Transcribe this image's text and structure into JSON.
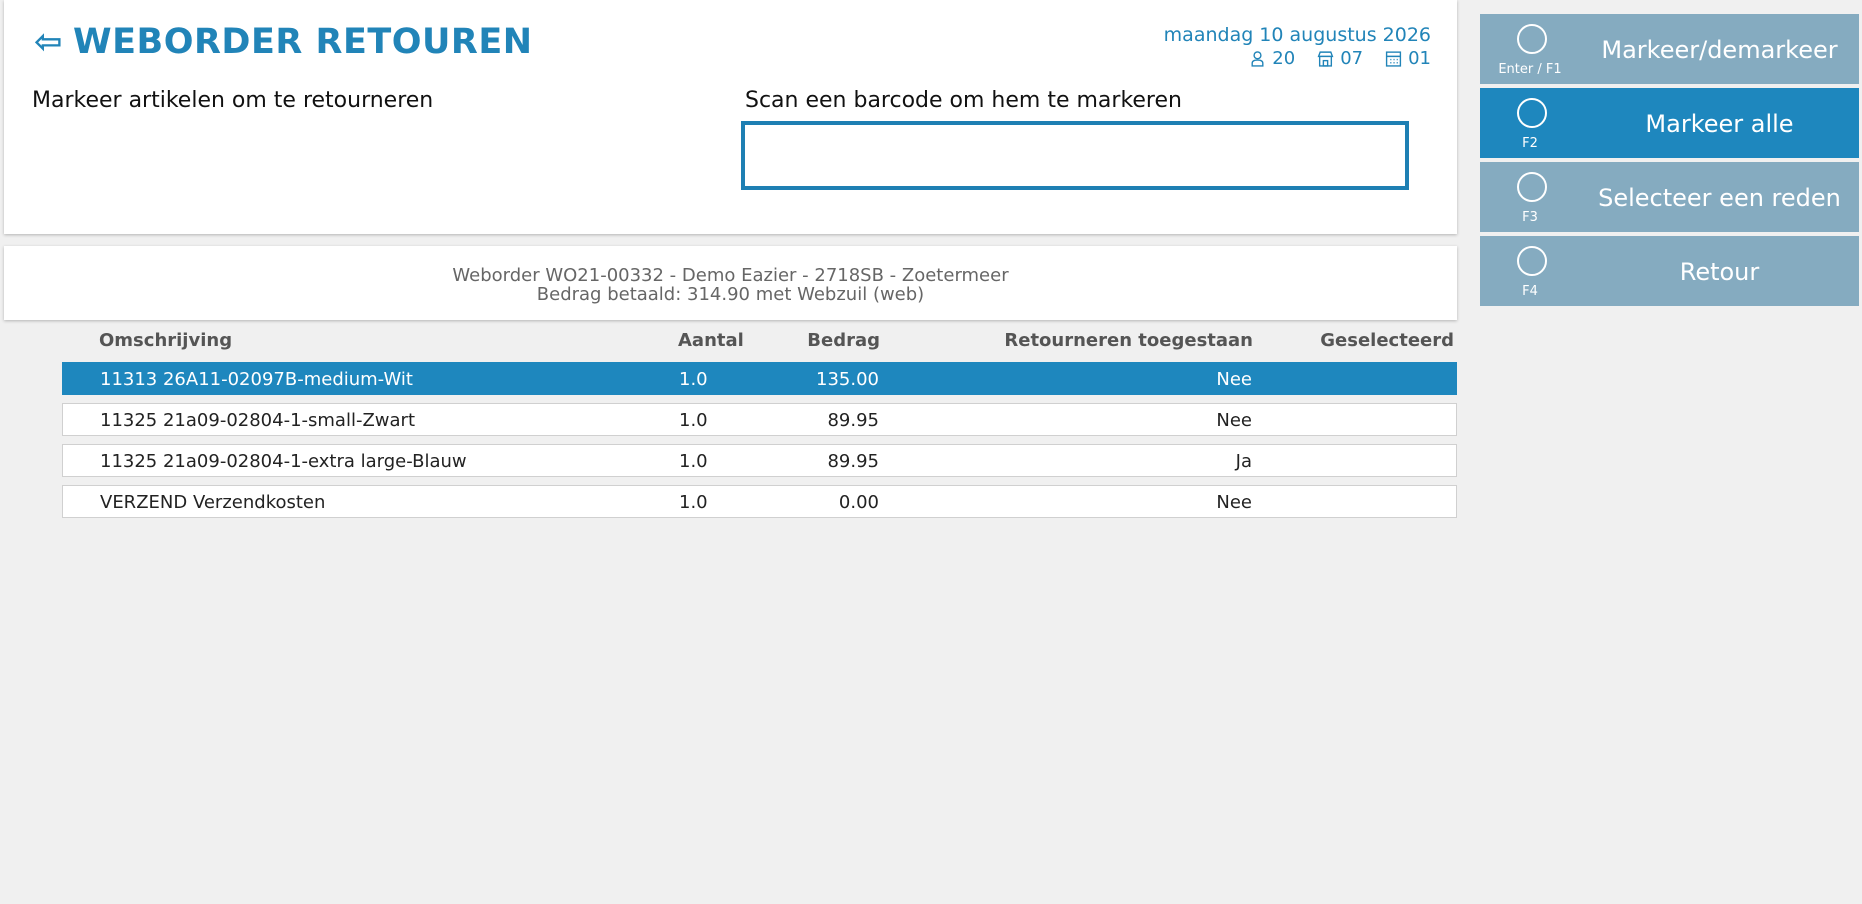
{
  "header": {
    "title": "WEBORDER RETOUREN",
    "date": "maandag 10 augustus 2026",
    "user_count": "20",
    "store_code": "07",
    "register_code": "01",
    "left_label": "Markeer artikelen om te retourneren",
    "scan_label": "Scan een barcode om hem te markeren",
    "scan_value": ""
  },
  "order": {
    "line1": "Weborder WO21-00332 - Demo Eazier - 2718SB - Zoetermeer",
    "line2": "Bedrag betaald: 314.90 met Webzuil (web)"
  },
  "table": {
    "headers": {
      "description": "Omschrijving",
      "quantity": "Aantal",
      "amount": "Bedrag",
      "return_allowed": "Retourneren toegestaan",
      "selected": "Geselecteerd"
    },
    "rows": [
      {
        "description": "11313 26A11-02097B-medium-Wit",
        "quantity": "1.0",
        "amount": "135.00",
        "return_allowed": "Nee",
        "selected": ""
      },
      {
        "description": "11325 21a09-02804-1-small-Zwart",
        "quantity": "1.0",
        "amount": "89.95",
        "return_allowed": "Nee",
        "selected": ""
      },
      {
        "description": "11325 21a09-02804-1-extra large-Blauw",
        "quantity": "1.0",
        "amount": "89.95",
        "return_allowed": "Ja",
        "selected": ""
      },
      {
        "description": "VERZEND Verzendkosten",
        "quantity": "1.0",
        "amount": "0.00",
        "return_allowed": "Nee",
        "selected": ""
      }
    ]
  },
  "sidebar": {
    "buttons": [
      {
        "key": "Enter / F1",
        "label": "Markeer/demarkeer"
      },
      {
        "key": "F2",
        "label": "Markeer alle"
      },
      {
        "key": "F3",
        "label": "Selecteer een reden"
      },
      {
        "key": "F4",
        "label": "Retour"
      }
    ]
  },
  "colors": {
    "accent": "#2184b8",
    "selected_row": "#1e87be",
    "button": "#85abc0",
    "button_active": "#1e87be"
  }
}
